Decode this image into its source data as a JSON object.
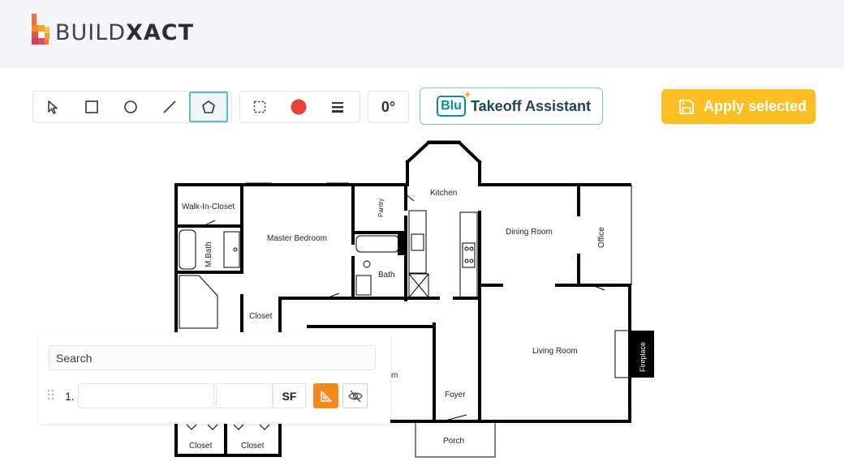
{
  "brand": {
    "name_light": "BUILD",
    "name_bold": "XACT"
  },
  "toolbar": {
    "tools": [
      {
        "name": "select-tool",
        "icon": "pointer-arrow-icon"
      },
      {
        "name": "rectangle-tool",
        "icon": "square-icon"
      },
      {
        "name": "circle-tool",
        "icon": "circle-icon"
      },
      {
        "name": "line-tool",
        "icon": "line-icon"
      },
      {
        "name": "polygon-tool",
        "icon": "pentagon-icon",
        "active": true
      }
    ],
    "style_tools": [
      {
        "name": "dashed-rectangle-tool",
        "icon": "dashed-square-icon"
      },
      {
        "name": "color-tool",
        "icon": "color-dot-icon",
        "color": "#e8403a"
      },
      {
        "name": "line-weight-tool",
        "icon": "line-weight-icon"
      }
    ],
    "rotation": "0°",
    "assistant": {
      "badge": "Blu",
      "label": "Takeoff Assistant"
    },
    "apply_label": "Apply selected",
    "accent_color": "#fbbf24"
  },
  "floorplan": {
    "rooms": {
      "walk_in_closet": "Walk-In-Closet",
      "master_bedroom": "Master Bedroom",
      "pantry": "Pantry",
      "kitchen": "Kitchen",
      "dining_room": "Dining Room",
      "office": "Office",
      "m_bath": "M.Bath",
      "bath": "Bath",
      "closet_1": "Closet",
      "living_room": "Living Room",
      "fireplace": "Fireplace",
      "partial_room": "m",
      "foyer": "Foyer",
      "porch": "Porch",
      "closet_2": "Closet",
      "closet_3": "Closet"
    }
  },
  "panel": {
    "search_placeholder": "Search",
    "rows": [
      {
        "index": "1.",
        "name": "",
        "value": "",
        "unit": "SF"
      }
    ],
    "measure_color": "#f5871f"
  }
}
